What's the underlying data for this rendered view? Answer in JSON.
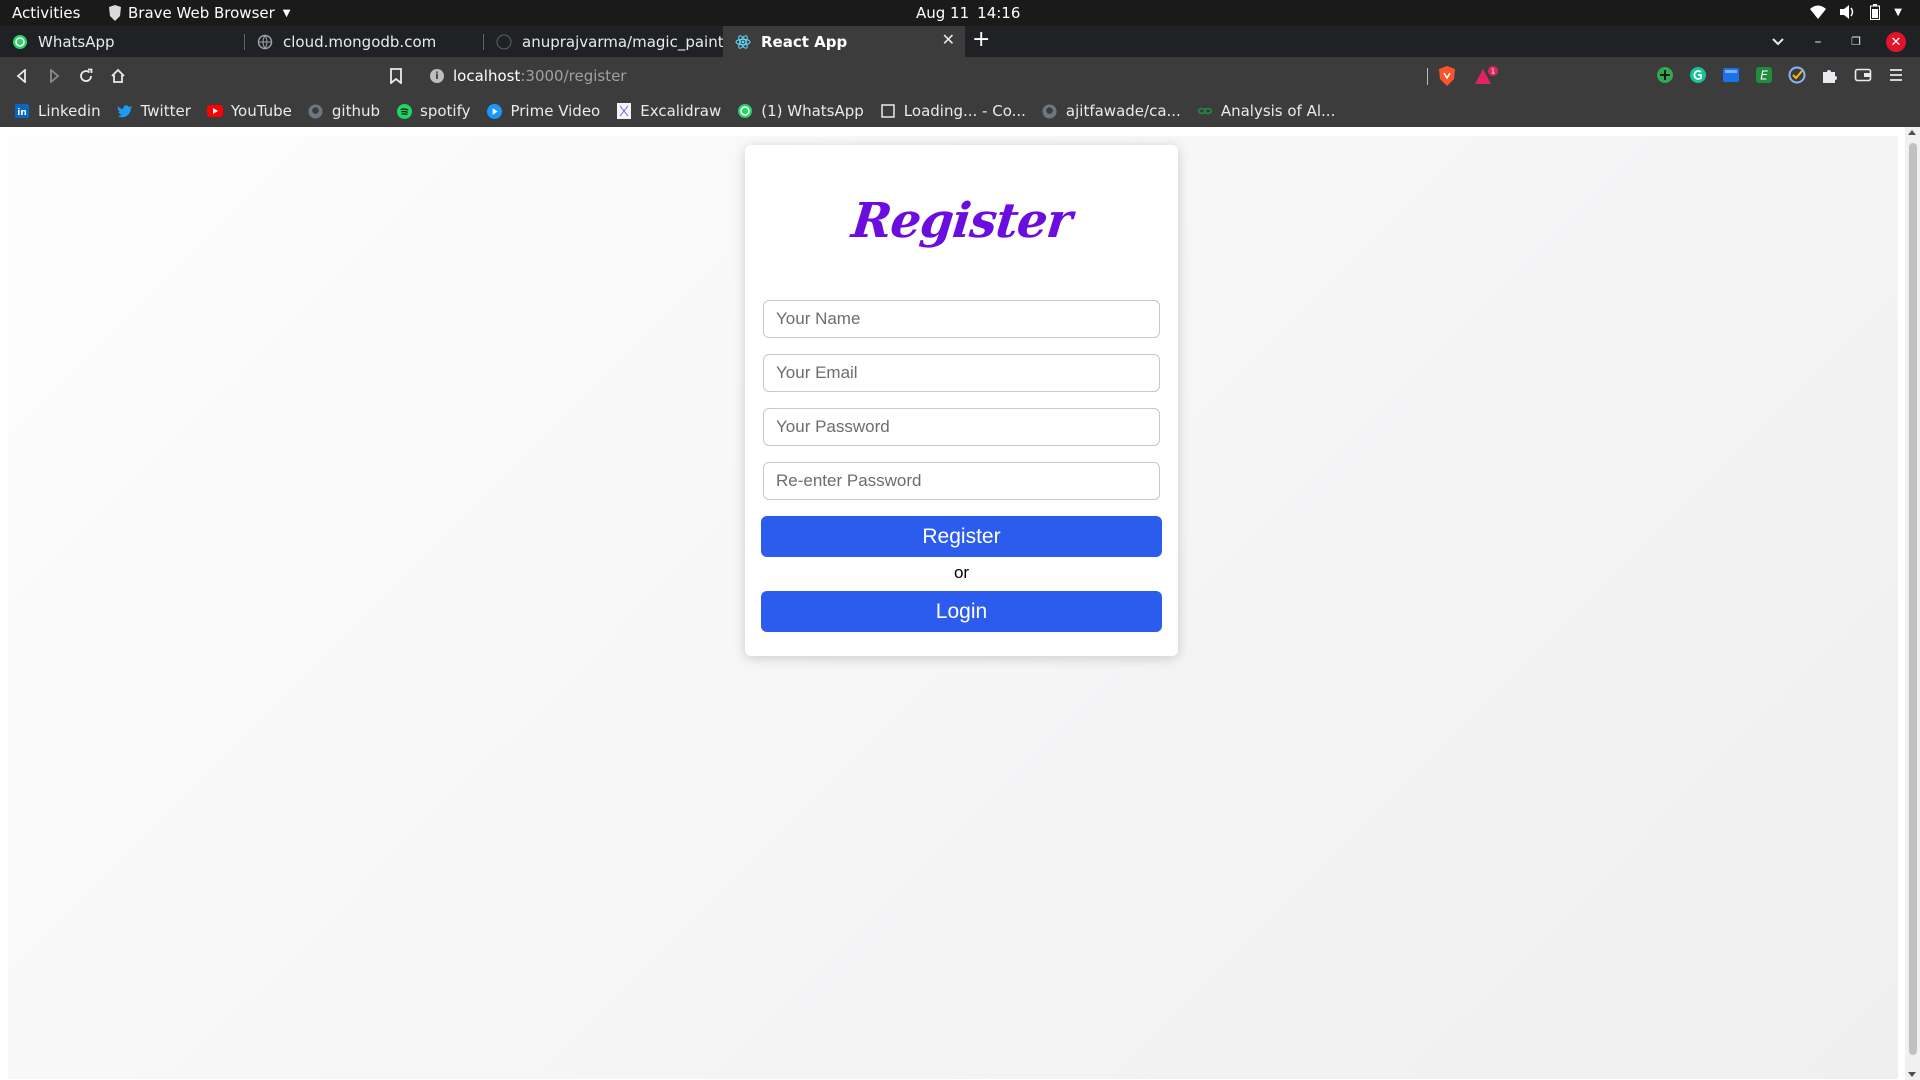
{
  "system_bar": {
    "activities": "Activities",
    "app_name": "Brave Web Browser",
    "date": "Aug 11",
    "time": "14:16"
  },
  "tabs": [
    {
      "title": "WhatsApp",
      "icon": "whatsapp-icon",
      "active": false
    },
    {
      "title": "cloud.mongodb.com",
      "icon": "globe-icon",
      "active": false
    },
    {
      "title": "anuprajvarma/magic_paint",
      "icon": "github-icon",
      "active": false
    },
    {
      "title": "React App",
      "icon": "react-icon",
      "active": true
    }
  ],
  "address_bar": {
    "host": "localhost",
    "path": ":3000/register"
  },
  "bookmarks": [
    {
      "label": "Linkedin",
      "icon": "linkedin-icon"
    },
    {
      "label": "Twitter",
      "icon": "twitter-icon"
    },
    {
      "label": "YouTube",
      "icon": "youtube-icon"
    },
    {
      "label": "github",
      "icon": "github-icon"
    },
    {
      "label": "spotify",
      "icon": "spotify-icon"
    },
    {
      "label": "Prime Video",
      "icon": "prime-video-icon"
    },
    {
      "label": "Excalidraw",
      "icon": "excalidraw-icon"
    },
    {
      "label": "(1) WhatsApp",
      "icon": "whatsapp-icon"
    },
    {
      "label": "Loading... - Co...",
      "icon": "page-icon"
    },
    {
      "label": "ajitfawade/ca...",
      "icon": "github-icon"
    },
    {
      "label": "Analysis of Al...",
      "icon": "link-icon"
    }
  ],
  "form": {
    "title": "Register",
    "name_placeholder": "Your Name",
    "email_placeholder": "Your Email",
    "password_placeholder": "Your Password",
    "confirm_placeholder": "Re-enter Password",
    "register_label": "Register",
    "or_text": "or",
    "login_label": "Login"
  },
  "colors": {
    "title_purple": "#6a0dde",
    "button_blue": "#2b5ced",
    "close_red": "#e3132b"
  }
}
